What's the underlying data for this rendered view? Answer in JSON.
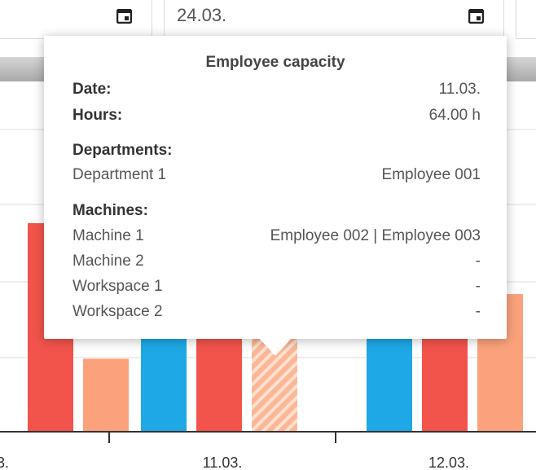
{
  "date_inputs": {
    "left_value": "",
    "right_value": "24.03."
  },
  "tooltip": {
    "title": "Employee capacity",
    "date_label": "Date:",
    "date_value": "11.03.",
    "hours_label": "Hours:",
    "hours_value": "64.00 h",
    "departments_heading": "Departments:",
    "departments": [
      {
        "name": "Department 1",
        "value": "Employee 001"
      }
    ],
    "machines_heading": "Machines:",
    "machines": [
      {
        "name": "Machine 1",
        "value": "Employee 002 | Employee 003"
      },
      {
        "name": "Machine 2",
        "value": "-"
      },
      {
        "name": "Workspace 1",
        "value": "-"
      },
      {
        "name": "Workspace 2",
        "value": "-"
      }
    ]
  },
  "colors": {
    "blue": "#1ea8e6",
    "red": "#f2544b",
    "orange": "#fba27c",
    "grid": "#dddddd",
    "axis": "#333333"
  },
  "chart_data": {
    "type": "bar",
    "categories": [
      "3.",
      "11.03.",
      "12.03."
    ],
    "series": [
      {
        "values": [
          null,
          1.0,
          1.0
        ],
        "color": "#1ea8e6"
      },
      {
        "values": [
          1.0,
          1.0,
          1.0
        ],
        "color": "#f2544b"
      },
      {
        "values": [
          0.35,
          1.0,
          0.66
        ],
        "color": "#fba27c",
        "hatched_at": [
          1
        ]
      }
    ],
    "grid": true
  }
}
